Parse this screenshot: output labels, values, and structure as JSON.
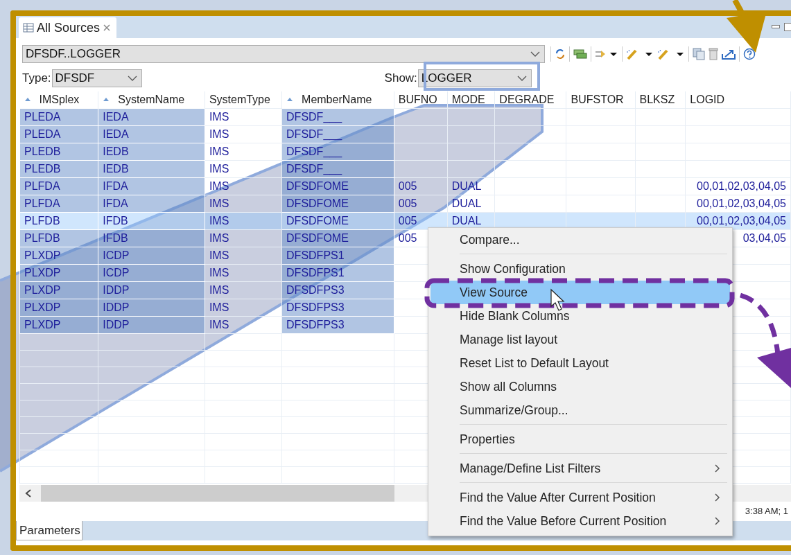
{
  "view_tab": {
    "label": "All Sources",
    "selected": true
  },
  "source_combo": {
    "value": "DFSDF..LOGGER"
  },
  "type_filter": {
    "label": "Type:",
    "value": "DFSDF"
  },
  "show_filter": {
    "label": "Show:",
    "value": "LOGGER"
  },
  "table": {
    "columns": [
      {
        "label": "IMSplex",
        "sorted": true,
        "highlighted": true
      },
      {
        "label": "SystemName",
        "sorted": true,
        "highlighted": true
      },
      {
        "label": "SystemType",
        "sorted": false,
        "highlighted": false
      },
      {
        "label": "MemberName",
        "sorted": true,
        "highlighted": true
      },
      {
        "label": "BUFNO",
        "sorted": false,
        "highlighted": false
      },
      {
        "label": "MODE",
        "sorted": false,
        "highlighted": false
      },
      {
        "label": "DEGRADE",
        "sorted": false,
        "highlighted": false
      },
      {
        "label": "BUFSTOR",
        "sorted": false,
        "highlighted": false
      },
      {
        "label": "BLKSZ",
        "sorted": false,
        "highlighted": false
      },
      {
        "label": "LOGID",
        "sorted": false,
        "highlighted": false
      }
    ],
    "rows": [
      {
        "cells": [
          "PLEDA",
          "IEDA",
          "IMS",
          "DFSDF___",
          null,
          null,
          null,
          null,
          null,
          null
        ],
        "focused": false
      },
      {
        "cells": [
          "PLEDA",
          "IEDA",
          "IMS",
          "DFSDF___",
          null,
          null,
          null,
          null,
          null,
          null
        ],
        "focused": false
      },
      {
        "cells": [
          "PLEDB",
          "IEDB",
          "IMS",
          "DFSDF___",
          null,
          null,
          null,
          null,
          null,
          null
        ],
        "focused": false
      },
      {
        "cells": [
          "PLEDB",
          "IEDB",
          "IMS",
          "DFSDF___",
          null,
          null,
          null,
          null,
          null,
          null
        ],
        "focused": false
      },
      {
        "cells": [
          "PLFDA",
          "IFDA",
          "IMS",
          "DFSDFOME",
          "005",
          "DUAL",
          null,
          null,
          null,
          "00,01,02,03,04,05"
        ],
        "focused": false
      },
      {
        "cells": [
          "PLFDA",
          "IFDA",
          "IMS",
          "DFSDFOME",
          "005",
          "DUAL",
          null,
          null,
          null,
          "00,01,02,03,04,05"
        ],
        "focused": false
      },
      {
        "cells": [
          "PLFDB",
          "IFDB",
          "IMS",
          "DFSDFOME",
          "005",
          "DUAL",
          null,
          null,
          null,
          "00,01,02,03,04,05"
        ],
        "focused": true
      },
      {
        "cells": [
          "PLFDB",
          "IFDB",
          "IMS",
          "DFSDFOME",
          "005",
          null,
          null,
          null,
          null,
          "03,04,05"
        ],
        "focused": false
      },
      {
        "cells": [
          "PLXDP",
          "ICDP",
          "IMS",
          "DFSDFPS1",
          null,
          null,
          null,
          null,
          null,
          null
        ],
        "focused": false
      },
      {
        "cells": [
          "PLXDP",
          "ICDP",
          "IMS",
          "DFSDFPS1",
          null,
          null,
          null,
          null,
          null,
          null
        ],
        "focused": false
      },
      {
        "cells": [
          "PLXDP",
          "IDDP",
          "IMS",
          "DFSDFPS3",
          null,
          null,
          null,
          null,
          null,
          null
        ],
        "focused": false
      },
      {
        "cells": [
          "PLXDP",
          "IDDP",
          "IMS",
          "DFSDFPS3",
          null,
          null,
          null,
          null,
          null,
          null
        ],
        "focused": false
      },
      {
        "cells": [
          "PLXDP",
          "IDDP",
          "IMS",
          "DFSDFPS3",
          null,
          null,
          null,
          null,
          null,
          null
        ],
        "focused": false
      }
    ]
  },
  "status_text": "3:38 AM; 1",
  "bottom_tab": {
    "label": "Parameters",
    "selected": true
  },
  "context_menu": {
    "items": [
      {
        "label": "Compare...",
        "selected": false,
        "submenu": false,
        "separator_after": true
      },
      {
        "label": "Show Configuration",
        "selected": false,
        "submenu": false,
        "separator_after": false
      },
      {
        "label": "View Source",
        "selected": true,
        "submenu": false,
        "separator_after": false
      },
      {
        "label": "Hide Blank Columns",
        "selected": false,
        "submenu": false,
        "separator_after": false
      },
      {
        "label": "Manage list layout",
        "selected": false,
        "submenu": false,
        "separator_after": false
      },
      {
        "label": "Reset List to Default Layout",
        "selected": false,
        "submenu": false,
        "separator_after": false
      },
      {
        "label": "Show all Columns",
        "selected": false,
        "submenu": false,
        "separator_after": false
      },
      {
        "label": "Summarize/Group...",
        "selected": false,
        "submenu": false,
        "separator_after": true
      },
      {
        "label": "Properties",
        "selected": false,
        "submenu": false,
        "separator_after": true
      },
      {
        "label": "Manage/Define List Filters",
        "selected": false,
        "submenu": true,
        "separator_after": true
      },
      {
        "label": "Find the Value After Current Position",
        "selected": false,
        "submenu": true,
        "separator_after": false
      },
      {
        "label": "Find the Value Before Current Position",
        "selected": false,
        "submenu": true,
        "separator_after": false
      }
    ]
  }
}
